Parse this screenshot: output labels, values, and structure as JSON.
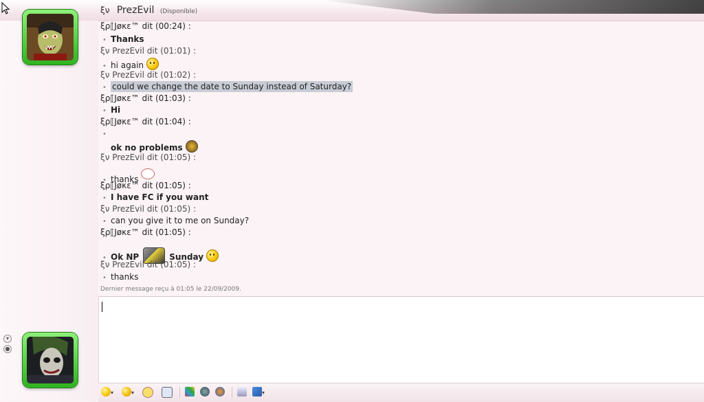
{
  "header": {
    "contact_prefix": "ξν",
    "contact_name": "PrezEvil",
    "status": "(Disponible)"
  },
  "messages": [
    {
      "sender": "ξρ⟦Jøκε™ dit (00:24) :",
      "lines": [
        "Thanks"
      ],
      "bold": true
    },
    {
      "sender": "ξν  PrezEvil dit (01:01) :",
      "lines": [
        "hi again"
      ],
      "bold": false
    },
    {
      "sender": "ξν  PrezEvil dit (01:02) :",
      "lines": [
        "could we change the date to Sunday instead of Saturday?"
      ],
      "bold": false
    },
    {
      "sender": "ξρ⟦Jøκε™ dit (01:03) :",
      "lines": [
        "Hi"
      ],
      "bold": true
    },
    {
      "sender": "ξρ⟦Jøκε™ dit (01:04) :",
      "lines": [
        "",
        "ok no problems"
      ],
      "bold": true
    },
    {
      "sender": "ξν  PrezEvil dit (01:05) :",
      "lines": [
        "thanks"
      ],
      "bold": false
    },
    {
      "sender": "ξρ⟦Jøκε™ dit (01:05) :",
      "lines": [
        "I have FC if you want"
      ],
      "bold": true
    },
    {
      "sender": "ξν  PrezEvil dit (01:05) :",
      "lines": [
        "can you give it to me on Sunday?"
      ],
      "bold": false
    },
    {
      "sender": "ξρ⟦Jøκε™ dit (01:05) :",
      "lines": [
        "Ok NP",
        "Sunday"
      ],
      "bold": true
    },
    {
      "sender": "ξν  PrezEvil dit (01:05) :",
      "lines": [
        "thanks"
      ],
      "bold": false
    }
  ],
  "footer_note": "Dernier message reçu à 01:05 le 22/09/2009.",
  "input": {
    "value": ""
  },
  "toolbar": {
    "icons": [
      "emoticon-icon",
      "wink-icon",
      "nudge-icon",
      "voice-clip-icon",
      "background-icon",
      "games-icon",
      "activities-icon",
      "font-icon",
      "block-icon"
    ],
    "dropdown_marker": "▾"
  },
  "colors": {
    "avatar_frame": "#2fb31f",
    "highlight": "#c8ccd6"
  }
}
